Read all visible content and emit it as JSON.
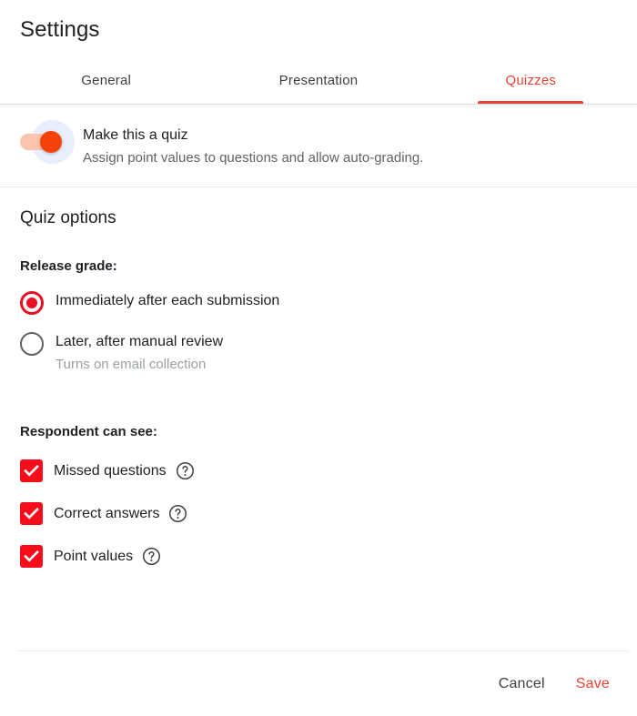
{
  "dialog": {
    "title": "Settings"
  },
  "tabs": [
    {
      "label": "General",
      "active": false,
      "name": "tab-general"
    },
    {
      "label": "Presentation",
      "active": false,
      "name": "tab-presentation"
    },
    {
      "label": "Quizzes",
      "active": true,
      "name": "tab-quizzes"
    }
  ],
  "quiz_toggle": {
    "title": "Make this a quiz",
    "description": "Assign point values to questions and allow auto-grading.",
    "state": "on"
  },
  "quiz_options": {
    "heading": "Quiz options",
    "release_grade": {
      "label": "Release grade:",
      "options": [
        {
          "label": "Immediately after each submission",
          "sublabel": "",
          "selected": true
        },
        {
          "label": "Later, after manual review",
          "sublabel": "Turns on email collection",
          "selected": false
        }
      ]
    },
    "respondent_can_see": {
      "label": "Respondent can see:",
      "options": [
        {
          "label": "Missed questions",
          "checked": true,
          "help": "?"
        },
        {
          "label": "Correct answers",
          "checked": true,
          "help": "?"
        },
        {
          "label": "Point values",
          "checked": true,
          "help": "?"
        }
      ]
    }
  },
  "footer": {
    "cancel_label": "Cancel",
    "save_label": "Save"
  },
  "colors": {
    "accent_red": "#ea4335",
    "checkbox_red": "#f50d1c",
    "radio_red": "#e81123",
    "toggle_thumb": "#f4420a",
    "toggle_track": "#fbc4ae",
    "toggle_ripple": "#e8eefc",
    "text_primary": "#202124",
    "text_secondary": "#5f6368",
    "text_muted": "#9aa0a6",
    "divider": "#e8eaed"
  }
}
